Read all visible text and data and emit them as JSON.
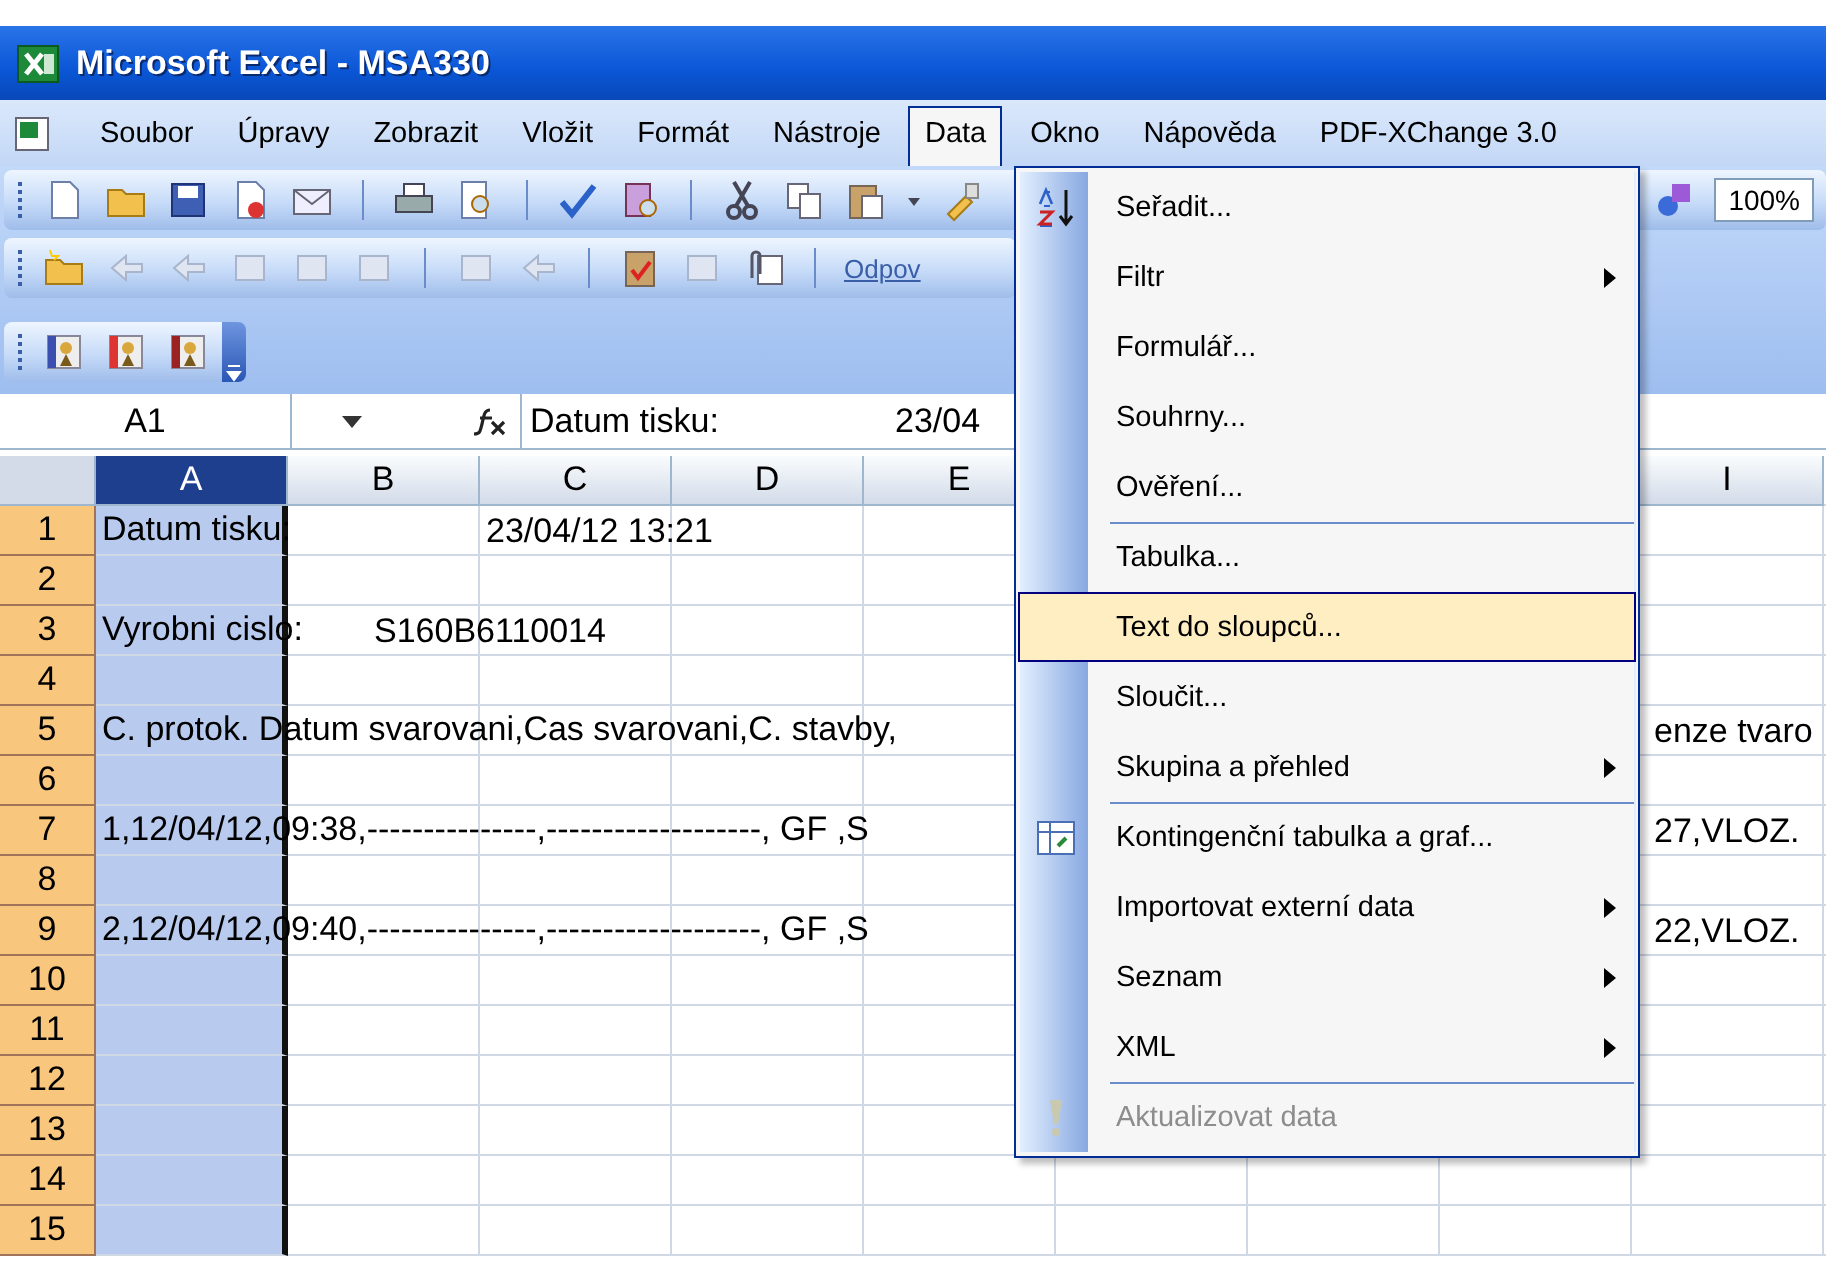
{
  "window": {
    "title": "Microsoft Excel - MSA330"
  },
  "menu_bar": [
    {
      "label": "Soubor",
      "selected": false
    },
    {
      "label": "Úpravy",
      "selected": false
    },
    {
      "label": "Zobrazit",
      "selected": false
    },
    {
      "label": "Vložit",
      "selected": false
    },
    {
      "label": "Formát",
      "selected": false
    },
    {
      "label": "Nástroje",
      "selected": false
    },
    {
      "label": "Data",
      "selected": true
    },
    {
      "label": "Okno",
      "selected": false
    },
    {
      "label": "Nápověda",
      "selected": false
    },
    {
      "label": "PDF-XChange 3.0",
      "selected": false
    }
  ],
  "standard_toolbar": {
    "zoom": "100%"
  },
  "reviewing_toolbar": {
    "reply_label": "Odpov"
  },
  "formula_bar": {
    "name_box": "A1",
    "formula": "Datum tisku:",
    "formula_tail": "23/04"
  },
  "sheet": {
    "columns": [
      {
        "label": "A",
        "selected": true
      },
      {
        "label": "B",
        "selected": false
      },
      {
        "label": "C",
        "selected": false
      },
      {
        "label": "D",
        "selected": false
      },
      {
        "label": "E",
        "selected": false
      },
      {
        "label": "I",
        "selected": false
      }
    ],
    "rows": [
      {
        "number": "1",
        "column_a": "Datum tisku:",
        "column_c": "23/04/12  13:21"
      },
      {
        "number": "2"
      },
      {
        "number": "3",
        "column_a": "Vyrobni cislo:",
        "column_b": "S160B6110014"
      },
      {
        "number": "4"
      },
      {
        "number": "5",
        "column_a": "C. protok. Datum svarovani,Cas svarovani,C. stavby,",
        "column_i": "enze tvaro"
      },
      {
        "number": "6"
      },
      {
        "number": "7",
        "column_a": "1,12/04/12,09:38,---------------,-------------------, GF ,S",
        "column_i": "27,VLOZ."
      },
      {
        "number": "8"
      },
      {
        "number": "9",
        "column_a": "2,12/04/12,09:40,---------------,-------------------, GF ,S",
        "column_i": "22,VLOZ."
      },
      {
        "number": "10"
      },
      {
        "number": "11"
      },
      {
        "number": "12"
      },
      {
        "number": "13"
      },
      {
        "number": "14"
      },
      {
        "number": "15"
      }
    ]
  },
  "data_menu": [
    {
      "label": "Seřadit...",
      "submenu": false,
      "disabled": false,
      "selected": false,
      "separator_before": false
    },
    {
      "label": "Filtr",
      "submenu": true,
      "disabled": false,
      "selected": false,
      "separator_before": false
    },
    {
      "label": "Formulář...",
      "submenu": false,
      "disabled": false,
      "selected": false,
      "separator_before": false
    },
    {
      "label": "Souhrny...",
      "submenu": false,
      "disabled": false,
      "selected": false,
      "separator_before": false
    },
    {
      "label": "Ověření...",
      "submenu": false,
      "disabled": false,
      "selected": false,
      "separator_before": false
    },
    {
      "label": "Tabulka...",
      "submenu": false,
      "disabled": false,
      "selected": false,
      "separator_before": true
    },
    {
      "label": "Text do sloupců...",
      "submenu": false,
      "disabled": false,
      "selected": true,
      "separator_before": false
    },
    {
      "label": "Sloučit...",
      "submenu": false,
      "disabled": false,
      "selected": false,
      "separator_before": false
    },
    {
      "label": "Skupina a přehled",
      "submenu": true,
      "disabled": false,
      "selected": false,
      "separator_before": false
    },
    {
      "label": "Kontingenční tabulka a graf...",
      "submenu": false,
      "disabled": false,
      "selected": false,
      "separator_before": true
    },
    {
      "label": "Importovat externí data",
      "submenu": true,
      "disabled": false,
      "selected": false,
      "separator_before": false
    },
    {
      "label": "Seznam",
      "submenu": true,
      "disabled": false,
      "selected": false,
      "separator_before": false
    },
    {
      "label": "XML",
      "submenu": true,
      "disabled": false,
      "selected": false,
      "separator_before": false
    },
    {
      "label": "Aktualizovat data",
      "submenu": false,
      "disabled": true,
      "selected": false,
      "separator_before": true
    }
  ]
}
